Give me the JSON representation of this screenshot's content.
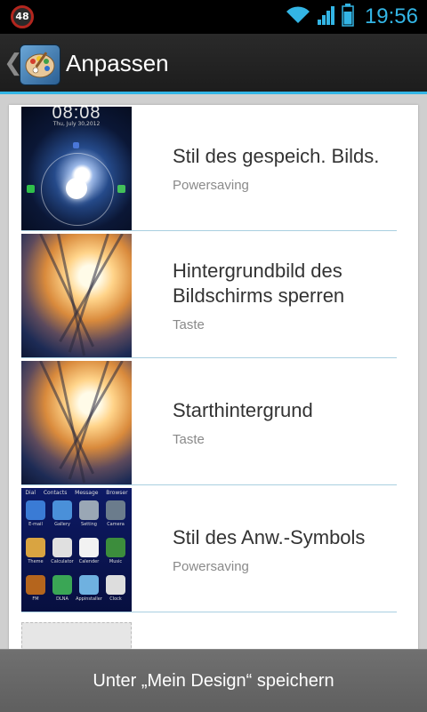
{
  "status_bar": {
    "notification_count": "48",
    "time": "19:56",
    "accent": "#33b5e5",
    "icons": [
      "wifi-icon",
      "signal-icon",
      "battery-icon"
    ]
  },
  "action_bar": {
    "title": "Anpassen",
    "back_icon": "chevron-left-icon",
    "app_icon": "palette-icon"
  },
  "lock_preview": {
    "time": "08:08",
    "date": "Thu, July 30,2012"
  },
  "items": [
    {
      "title": "Stil des gespeich. Bilds.",
      "subtitle": "Powersaving",
      "thumb": "lockscreen-style"
    },
    {
      "title": "Hintergrundbild des Bildschirms sperren",
      "subtitle": "Taste",
      "thumb": "lockscreen-wallpaper"
    },
    {
      "title": "Starthintergrund",
      "subtitle": "Taste",
      "thumb": "home-wallpaper"
    },
    {
      "title": "Stil des Anw.-Symbols",
      "subtitle": "Powersaving",
      "thumb": "app-icon-style"
    }
  ],
  "icon_grid": {
    "top_labels": [
      "Dial",
      "Contacts",
      "Message",
      "Browser"
    ],
    "labels": [
      "E-mail",
      "Gallery",
      "Setting",
      "Camera",
      "Theme",
      "Calculator",
      "Calender",
      "Music",
      "FM",
      "DLNA",
      "Appinstaller",
      "Clock"
    ]
  },
  "bottom_button": {
    "label": "Unter „Mein Design“ speichern"
  }
}
